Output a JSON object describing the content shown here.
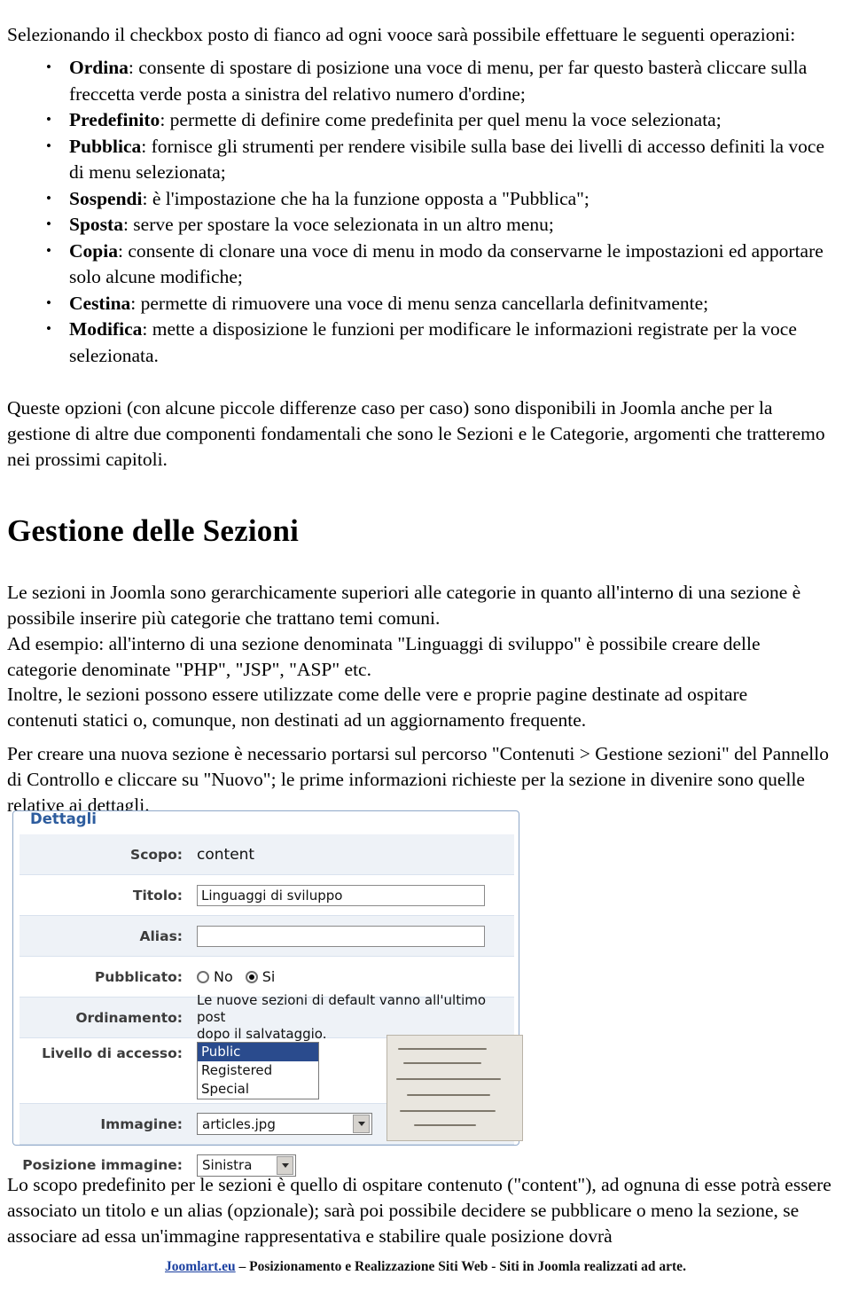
{
  "document": {
    "intro": "Selezionando il checkbox posto di fianco ad ogni vooce sarà possibile effettuare le seguenti operazioni:",
    "operations": [
      {
        "term": "Ordina",
        "text": ": consente di spostare di posizione una voce di menu, per far questo basterà cliccare sulla freccetta verde posta a sinistra del relativo numero d'ordine;"
      },
      {
        "term": "Predefinito",
        "text": ": permette di definire come predefinita per quel menu la voce selezionata;"
      },
      {
        "term": "Pubblica",
        "text": ": fornisce gli strumenti per rendere visibile sulla base dei livelli di accesso definiti la voce di menu selezionata;"
      },
      {
        "term": "Sospendi",
        "text": ": è l'impostazione che ha la funzione opposta a \"Pubblica\";"
      },
      {
        "term": "Sposta",
        "text": ": serve per spostare la voce selezionata in un altro menu;"
      },
      {
        "term": "Copia",
        "text": ": consente di clonare una voce di menu in modo da conservarne le impostazioni ed apportare solo alcune modifiche;"
      },
      {
        "term": "Cestina",
        "text": ": permette di rimuovere una voce di menu senza cancellarla definitvamente;"
      },
      {
        "term": "Modifica",
        "text": ": mette a disposizione le funzioni per modificare le informazioni registrate per la voce selezionata."
      }
    ],
    "paragraph_queste": "Queste opzioni (con alcune piccole differenze caso per caso) sono disponibili in Joomla anche per la gestione di altre due componenti fondamentali che sono le Sezioni e le Categorie, argomenti che tratteremo nei prossimi capitoli.",
    "section_heading": "Gestione delle Sezioni",
    "paragraph_sezioni": "Le sezioni in Joomla sono gerarchicamente superiori alle categorie in quanto all'interno di una sezione è possibile inserire più categorie che trattano temi comuni.",
    "paragraph_esempio": "Ad esempio: all'interno di una sezione denominata \"Linguaggi di sviluppo\" è possibile creare delle categorie denominate \"PHP\", \"JSP\", \"ASP\" etc.",
    "paragraph_inoltre": "Inoltre, le sezioni possono essere utilizzate come delle vere e proprie pagine destinate ad ospitare contenuti statici o, comunque, non destinati ad un aggiornamento frequente.",
    "paragraph_creare": "Per creare una nuova sezione è necessario portarsi sul percorso \"Contenuti > Gestione sezioni\" del Pannello di Controllo e cliccare su \"Nuovo\"; le prime informazioni richieste per la sezione in divenire sono quelle relative ai dettagli.",
    "paragraph_scopo": "Lo scopo predefinito per le sezioni è quello di ospitare contenuto (\"content\"), ad ognuna di esse potrà essere associato un titolo e un alias (opzionale); sarà poi possibile decidere se pubblicare o meno la sezione, se associare ad essa un'immagine rappresentativa e stabilire quale posizione dovrà"
  },
  "screenshot": {
    "legend": "Dettagli",
    "fields": {
      "scopo_label": "Scopo:",
      "scopo_value": "content",
      "titolo_label": "Titolo:",
      "titolo_value": "Linguaggi di sviluppo",
      "alias_label": "Alias:",
      "alias_value": "",
      "pubblicato_label": "Pubblicato:",
      "pubblicato_no": "No",
      "pubblicato_si": "Si",
      "pubblicato_selected": "Si",
      "ordinamento_label": "Ordinamento:",
      "ordinamento_note": "Le nuove sezioni di default vanno all'ultimo post\ndopo il salvataggio.",
      "accesso_label": "Livello di accesso:",
      "accesso_options": [
        "Public",
        "Registered",
        "Special"
      ],
      "accesso_selected": "Public",
      "immagine_label": "Immagine:",
      "immagine_value": "articles.jpg",
      "posizione_label": "Posizione immagine:",
      "posizione_value": "Sinistra"
    }
  },
  "footer": {
    "brand": "Joomlart.eu",
    "rest": " – Posizionamento e Realizzazione Siti Web - Siti in Joomla realizzati ad arte."
  }
}
